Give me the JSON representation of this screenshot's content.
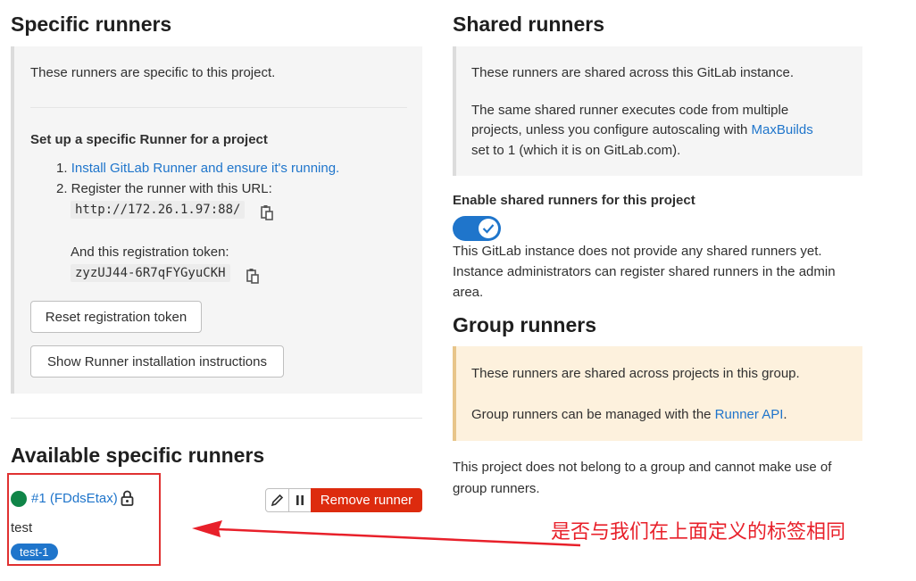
{
  "specific": {
    "title": "Specific runners",
    "intro": "These runners are specific to this project.",
    "setup_heading": "Set up a specific Runner for a project",
    "step1_prefix": "1. ",
    "step1_link": "Install GitLab Runner and ensure it's running.",
    "step2": "2. Register the runner with this URL:",
    "url": "http://172.26.1.97:88/",
    "token_label": "And this registration token:",
    "token": "zyzUJ44-6R7qFYGyuCKH",
    "reset_button": "Reset registration token",
    "instructions_button": "Show Runner installation instructions"
  },
  "available": {
    "title": "Available specific runners",
    "runner_link": "#1 (FDdsEtax)",
    "runner_description": "test",
    "tag": "test-1",
    "remove_button": "Remove runner"
  },
  "shared": {
    "title": "Shared runners",
    "line1": "These runners are shared across this GitLab instance.",
    "line2a": "The same shared runner executes code from multiple",
    "line2b": "projects, unless you configure autoscaling with ",
    "line2b_link": "MaxBuilds",
    "line2c": "set to 1 (which it is on GitLab.com).",
    "enable_label": "Enable shared runners for this project",
    "notice1": "This GitLab instance does not provide any shared runners yet.",
    "notice2": "Instance administrators can register shared runners in the admin",
    "notice3": "area."
  },
  "group": {
    "title": "Group runners",
    "line1": "These runners are shared across projects in this group.",
    "line2": "Group runners can be managed with the ",
    "line2_link": "Runner API",
    "line2_end": ".",
    "notice1": "This project does not belong to a group and cannot make use of",
    "notice2": "group runners."
  },
  "annotation": {
    "text": "是否与我们在上面定义的标签相同",
    "color": "#e8202a"
  },
  "colors": {
    "accent": "#1f75cb",
    "danger": "#dd2b0e",
    "online": "#108548"
  }
}
